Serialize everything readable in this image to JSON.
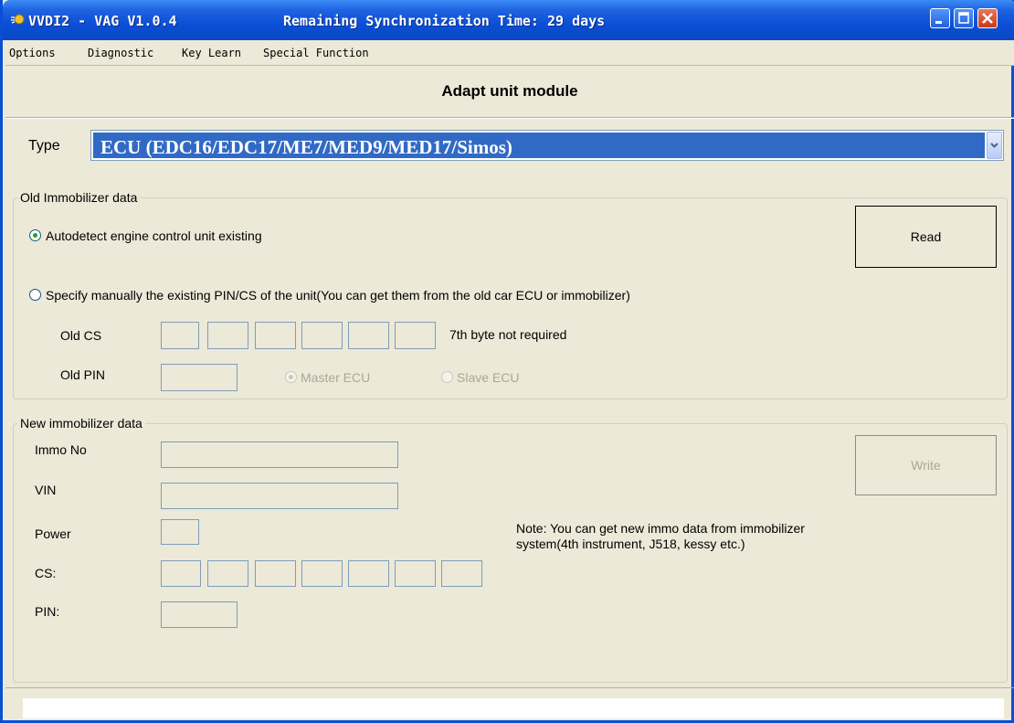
{
  "window": {
    "title": "VVDI2 - VAG V1.0.4",
    "sync_text": "Remaining Synchronization Time: 29 days"
  },
  "menu": {
    "items": [
      "Options",
      "Diagnostic",
      "Key Learn",
      "Special Function"
    ]
  },
  "header": {
    "title": "Adapt unit module"
  },
  "type": {
    "label": "Type",
    "selected": "ECU (EDC16/EDC17/ME7/MED9/MED17/Simos)"
  },
  "old_immo": {
    "legend": "Old Immobilizer data",
    "radio_auto": "Autodetect engine control unit existing",
    "radio_auto_checked": true,
    "radio_manual": "Specify manually the existing PIN/CS of the unit(You can get them from the old car ECU or immobilizer)",
    "radio_manual_checked": false,
    "old_cs_label": "Old CS",
    "old_cs_note": "7th byte not required",
    "old_pin_label": "Old PIN",
    "master_ecu": "Master ECU",
    "master_checked": true,
    "slave_ecu": "Slave ECU",
    "read_button": "Read"
  },
  "new_immo": {
    "legend": "New immobilizer data",
    "immo_no_label": "Immo No",
    "vin_label": "VIN",
    "power_label": "Power",
    "cs_label": "CS:",
    "pin_label": "PIN:",
    "write_button": "Write",
    "note": "Note: You can get new immo data from immobilizer system(4th instrument, J518, kessy etc.)"
  },
  "colors": {
    "titlebar": "#0b4fd6",
    "selection": "#316ac5",
    "window_bg": "#ece9d8"
  }
}
